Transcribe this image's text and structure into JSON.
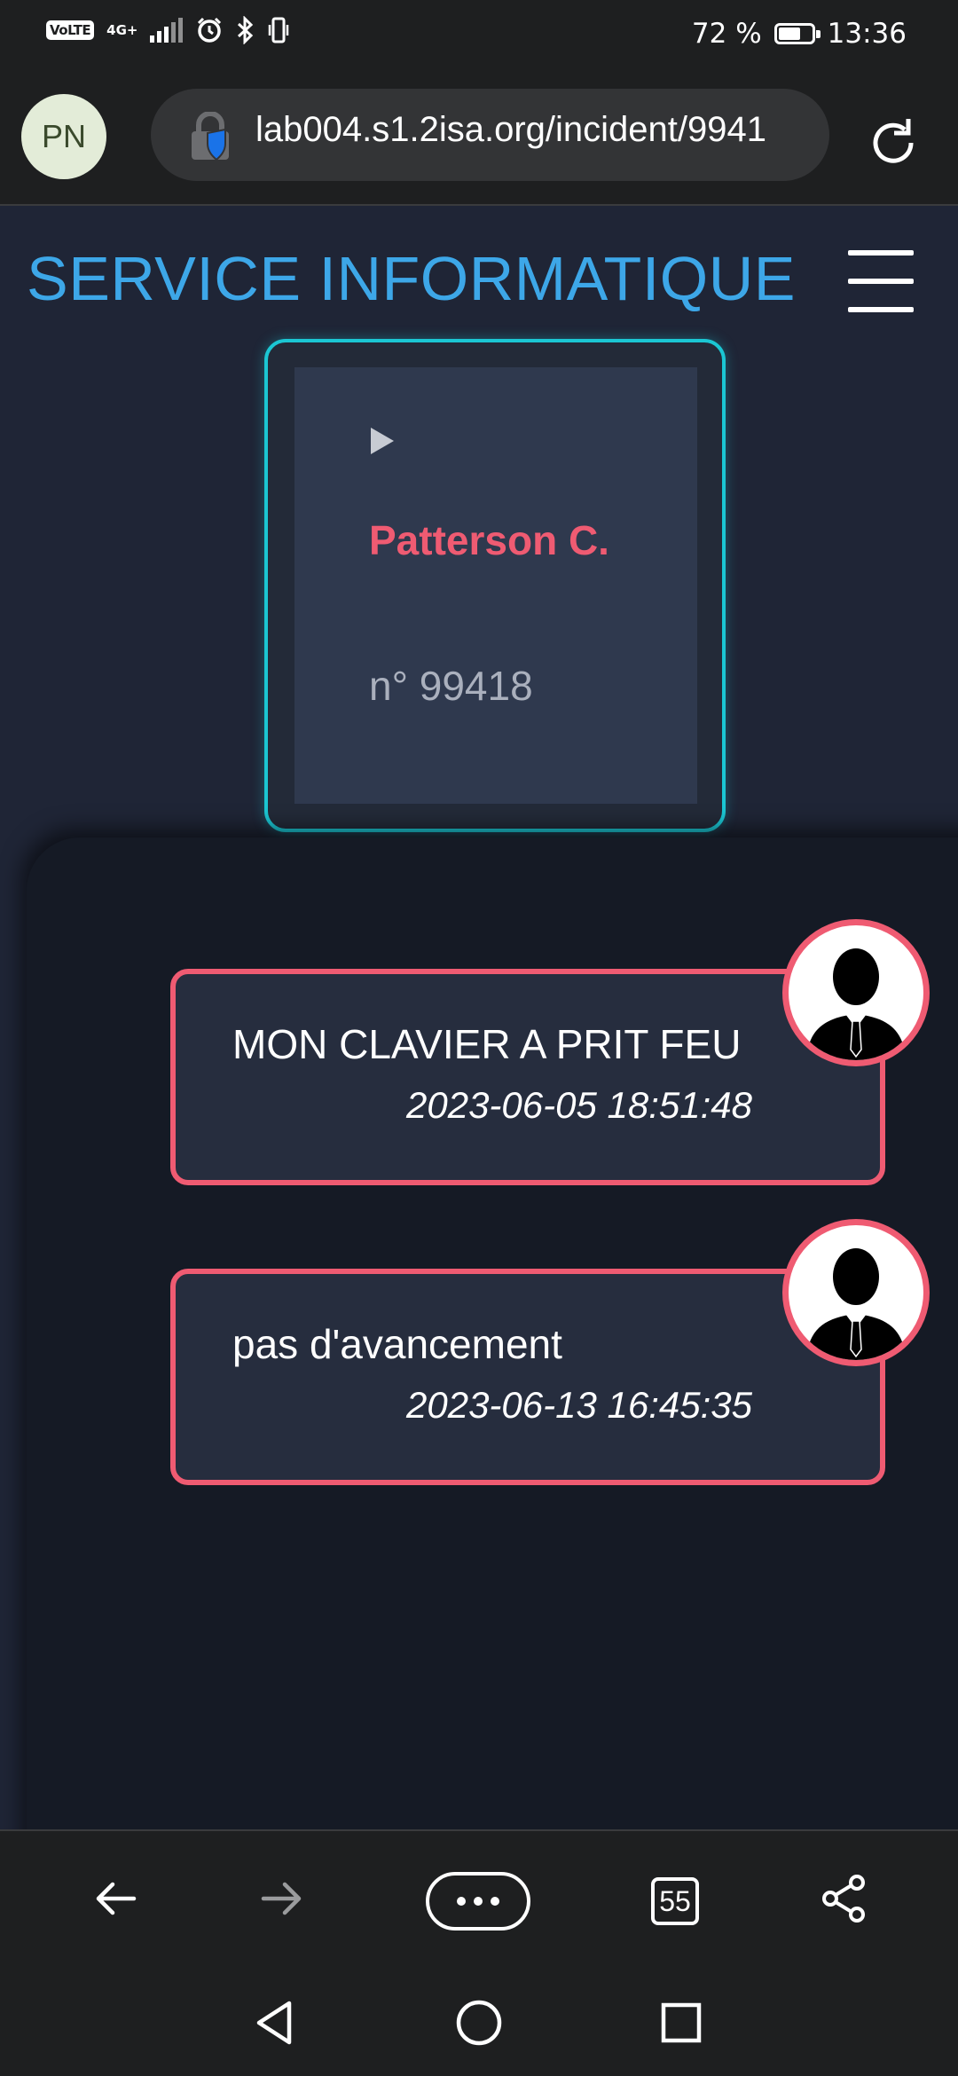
{
  "status_bar": {
    "volte": "VoLTE",
    "network": "4G+",
    "battery_percent": "72 %",
    "battery_level": 0.72,
    "time": "13:36"
  },
  "browser": {
    "profile_initials": "PN",
    "url": "lab004.s1.2isa.org/incident/9941",
    "tab_count": "55"
  },
  "page": {
    "site_title": "SERVICE INFORMATIQUE",
    "incident": {
      "requester": "Patterson C.",
      "number": "n° 99418"
    },
    "messages": [
      {
        "text": "MON CLAVIER A PRIT FEU",
        "timestamp": "2023-06-05 18:51:48"
      },
      {
        "text": "pas d'avancement",
        "timestamp": "2023-06-13 16:45:35"
      }
    ]
  },
  "colors": {
    "title_blue": "#3da7e8",
    "card_border": "#1bc6d3",
    "accent_pink": "#ef5b72"
  },
  "icons": {
    "status": [
      "volte-icon",
      "signal-icon",
      "alarm-icon",
      "bluetooth-icon",
      "vibrate-icon",
      "battery-icon"
    ],
    "toolbar": [
      "lock-icon",
      "reload-icon",
      "hamburger-icon",
      "play-icon",
      "user-avatar-icon"
    ],
    "nav": [
      "back-arrow-icon",
      "forward-arrow-icon",
      "more-icon",
      "tabs-icon",
      "share-icon",
      "system-back-icon",
      "system-home-icon",
      "system-recents-icon"
    ]
  }
}
